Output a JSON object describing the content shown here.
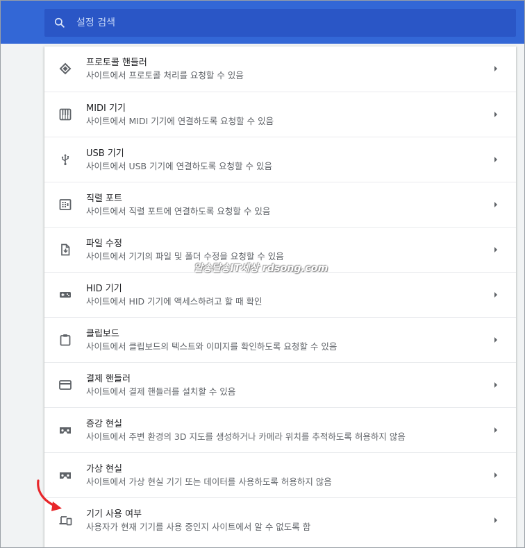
{
  "search": {
    "placeholder": "설정 검색",
    "icon": "search-icon"
  },
  "colors": {
    "header": "#3367d6",
    "search_bg": "#2a56c6",
    "annotation_arrow": "#e8262a"
  },
  "rows": [
    {
      "icon": "protocol-handler-icon",
      "title": "프로토콜 핸들러",
      "description": "사이트에서 프로토콜 처리를 요청할 수 있음"
    },
    {
      "icon": "midi-piano-icon",
      "title": "MIDI 기기",
      "description": "사이트에서 MIDI 기기에 연결하도록 요청할 수 있음"
    },
    {
      "icon": "usb-icon",
      "title": "USB 기기",
      "description": "사이트에서 USB 기기에 연결하도록 요청할 수 있음"
    },
    {
      "icon": "serial-port-icon",
      "title": "직렬 포트",
      "description": "사이트에서 직렬 포트에 연결하도록 요청할 수 있음"
    },
    {
      "icon": "file-edit-icon",
      "title": "파일 수정",
      "description": "사이트에서 기기의 파일 및 폴더 수정을 요청할 수 있음"
    },
    {
      "icon": "hid-gamepad-icon",
      "title": "HID 기기",
      "description": "사이트에서 HID 기기에 액세스하려고 할 때 확인"
    },
    {
      "icon": "clipboard-icon",
      "title": "클립보드",
      "description": "사이트에서 클립보드의 텍스트와 이미지를 확인하도록 요청할 수 있음"
    },
    {
      "icon": "credit-card-icon",
      "title": "결제 핸들러",
      "description": "사이트에서 결제 핸들러를 설치할 수 있음"
    },
    {
      "icon": "ar-headset-icon",
      "title": "증강 현실",
      "description": "사이트에서 주변 환경의 3D 지도를 생성하거나 카메라 위치를 추적하도록 허용하지 않음"
    },
    {
      "icon": "vr-headset-icon",
      "title": "가상 현실",
      "description": "사이트에서 가상 현실 기기 또는 데이터를 사용하도록 허용하지 않음"
    },
    {
      "icon": "device-usage-icon",
      "title": "기기 사용 여부",
      "description": "사용자가 현재 기기를 사용 중인지 사이트에서 알 수 없도록 함"
    }
  ],
  "watermark": "알송달송IT세상 rdsong.com"
}
